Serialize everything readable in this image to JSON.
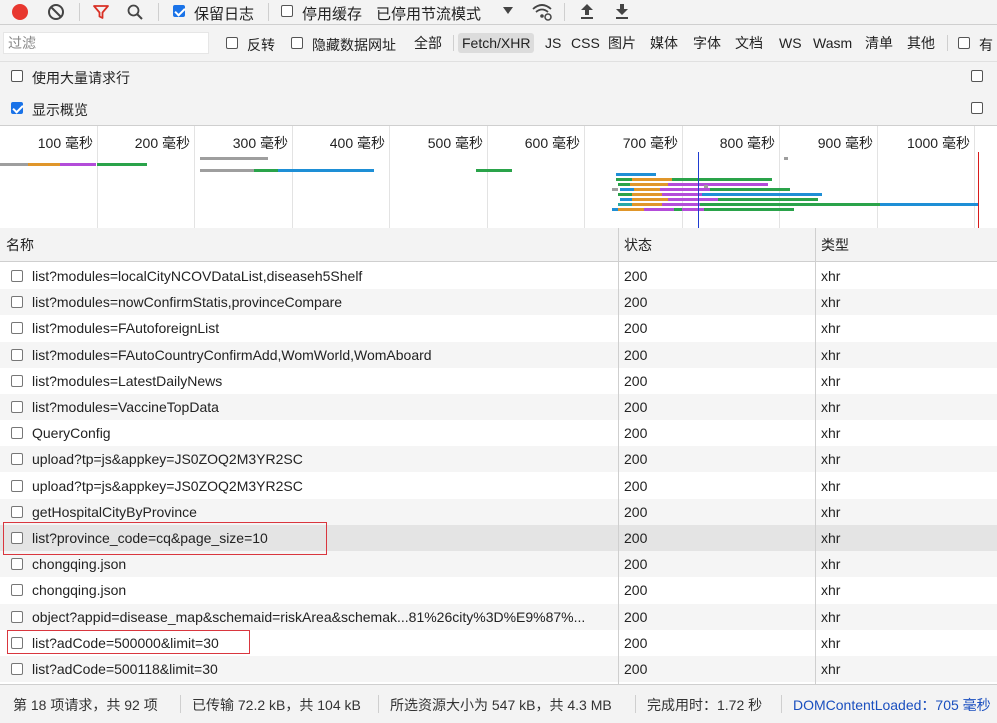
{
  "toolbar": {
    "preserve_log": "保留日志",
    "disable_cache": "停用缓存",
    "throttling": "已停用节流模式"
  },
  "filterbar": {
    "filter_placeholder": "过滤",
    "invert": "反转",
    "hide_data_urls": "隐藏数据网址",
    "types": [
      "全部",
      "Fetch/XHR",
      "JS",
      "CSS",
      "图片",
      "媒体",
      "字体",
      "文档",
      "WS",
      "Wasm",
      "清单",
      "其他"
    ],
    "active_type": "Fetch/XHR",
    "overflow_label": "有"
  },
  "options": {
    "large_rows": "使用大量请求行",
    "show_overview": "显示概览"
  },
  "overview": {
    "ticks": [
      "100 毫秒",
      "200 毫秒",
      "300 毫秒",
      "400 毫秒",
      "500 毫秒",
      "600 毫秒",
      "700 毫秒",
      "800 毫秒",
      "900 毫秒",
      "1000 毫秒"
    ]
  },
  "table": {
    "columns": [
      "名称",
      "状态",
      "类型"
    ],
    "rows": [
      {
        "name": "list?modules=localCityNCOVDataList,diseaseh5Shelf",
        "status": "200",
        "type": "xhr"
      },
      {
        "name": "list?modules=nowConfirmStatis,provinceCompare",
        "status": "200",
        "type": "xhr"
      },
      {
        "name": "list?modules=FAutoforeignList",
        "status": "200",
        "type": "xhr"
      },
      {
        "name": "list?modules=FAutoCountryConfirmAdd,WomWorld,WomAboard",
        "status": "200",
        "type": "xhr"
      },
      {
        "name": "list?modules=LatestDailyNews",
        "status": "200",
        "type": "xhr"
      },
      {
        "name": "list?modules=VaccineTopData",
        "status": "200",
        "type": "xhr"
      },
      {
        "name": "QueryConfig",
        "status": "200",
        "type": "xhr"
      },
      {
        "name": "upload?tp=js&appkey=JS0ZOQ2M3YR2SC",
        "status": "200",
        "type": "xhr"
      },
      {
        "name": "upload?tp=js&appkey=JS0ZOQ2M3YR2SC",
        "status": "200",
        "type": "xhr"
      },
      {
        "name": "getHospitalCityByProvince",
        "status": "200",
        "type": "xhr"
      },
      {
        "name": "list?province_code=cq&page_size=10",
        "status": "200",
        "type": "xhr"
      },
      {
        "name": "chongqing.json",
        "status": "200",
        "type": "xhr"
      },
      {
        "name": "chongqing.json",
        "status": "200",
        "type": "xhr"
      },
      {
        "name": "object?appid=disease_map&schemaid=riskArea&schemak...81%26city%3D%E9%87%...",
        "status": "200",
        "type": "xhr"
      },
      {
        "name": "list?adCode=500000&limit=30",
        "status": "200",
        "type": "xhr"
      },
      {
        "name": "list?adCode=500118&limit=30",
        "status": "200",
        "type": "xhr"
      }
    ]
  },
  "statusbar": {
    "requests": "第 18 项请求，共 92 项",
    "transferred": "已传输 72.2 kB，共 104 kB",
    "resources": "所选资源大小为 547 kB，共 4.3 MB",
    "finish": "完成用时：1.72 秒",
    "dom_loaded": "DOMContentLoaded：705 毫秒"
  },
  "colors": {
    "record": "#e8372f",
    "filter_active": "#d93025",
    "highlight_border": "#d9363e",
    "link": "#1a4fbf"
  }
}
